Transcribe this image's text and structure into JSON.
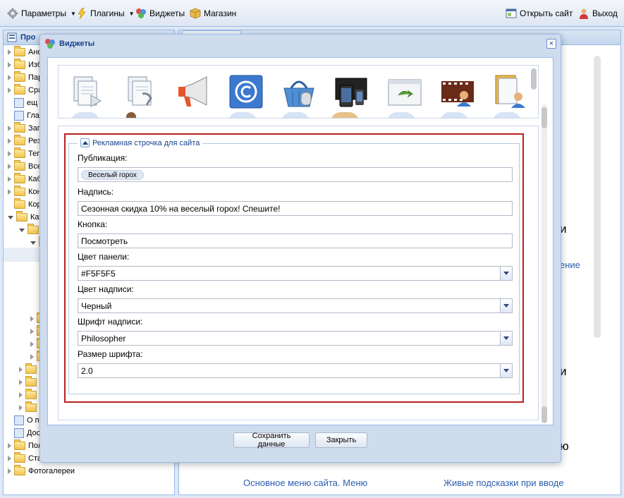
{
  "toolbar": {
    "settings": "Параметры",
    "plugins": "Плагины",
    "widgets": "Виджеты",
    "shop": "Магазин",
    "open_site": "Открыть сайт",
    "logout": "Выход"
  },
  "tree": {
    "header": "Про",
    "items": [
      "Ано",
      "Изб",
      "Пар",
      "Сра",
      "ещ",
      "Гла",
      "Зап",
      "Рез",
      "Тег",
      "Все",
      "Каб",
      "Кон",
      "Кор",
      "Кат"
    ],
    "lower_items": [
      "О п",
      "Дос",
      "Пол",
      "Ста",
      "Фотогалереи"
    ]
  },
  "main_bg": {
    "frag1": "и",
    "frag2": "ение",
    "frag3": "и",
    "frag4": "ю",
    "link1": "Основное меню сайта. Меню",
    "link2": "Живые подсказки при вводе"
  },
  "modal": {
    "title": "Виджеты",
    "close": "×",
    "section_title": "Рекламная строчка для сайта",
    "publication_label": "Публикация:",
    "publication_chip": "Веселый горох",
    "caption_label": "Надпись:",
    "caption_value": "Сезонная скидка 10% на веселый горох! Спешите!",
    "button_label": "Кнопка:",
    "button_value": "Посмотреть",
    "panel_color_label": "Цвет панели:",
    "panel_color_value": "#F5F5F5",
    "text_color_label": "Цвет надписи:",
    "text_color_value": "Черный",
    "font_label": "Шрифт надписи:",
    "font_value": "Philosopher",
    "font_size_label": "Размер шрифта:",
    "font_size_value": "2.0",
    "save_button": "Сохранить данные",
    "close_button": "Закрыть"
  },
  "colors": {
    "accent": "#15428b",
    "highlight_border": "#b82020",
    "panel_bg": "#dfe8f6"
  }
}
